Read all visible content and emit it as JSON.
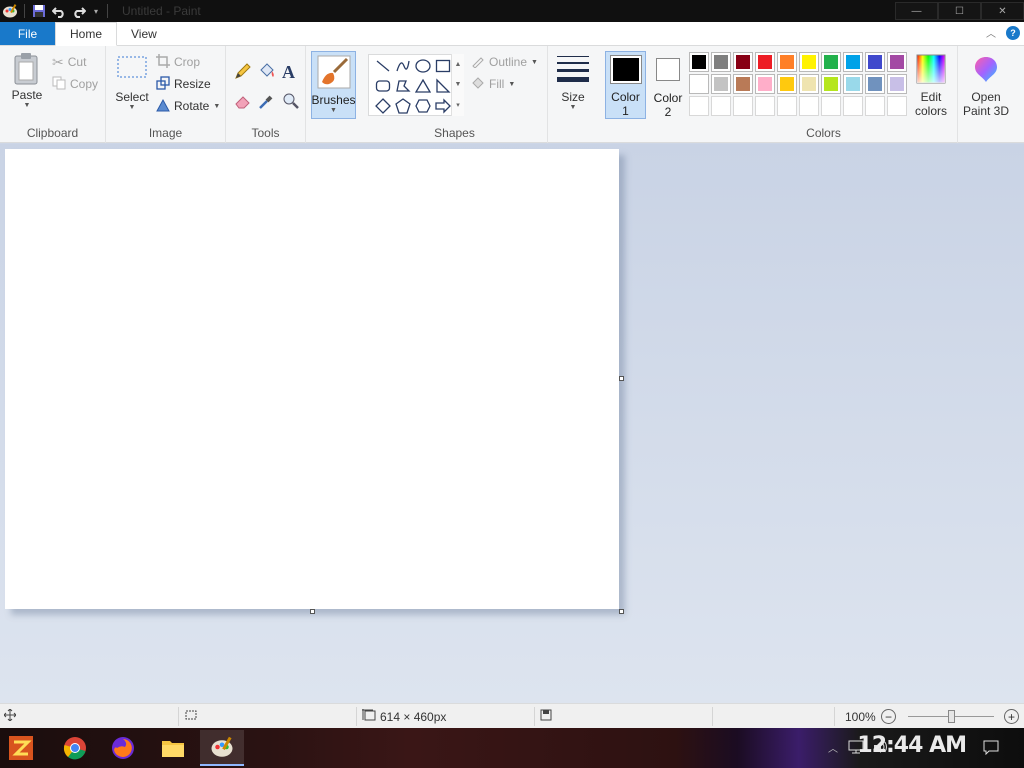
{
  "window": {
    "title": "Untitled - Paint"
  },
  "tabs": [
    {
      "label": "File"
    },
    {
      "label": "Home"
    },
    {
      "label": "View"
    }
  ],
  "ribbon": {
    "clipboard": {
      "label": "Clipboard",
      "paste": "Paste",
      "cut": "Cut",
      "copy": "Copy"
    },
    "image": {
      "label": "Image",
      "select": "Select",
      "crop": "Crop",
      "resize": "Resize",
      "rotate": "Rotate"
    },
    "tools": {
      "label": "Tools"
    },
    "brushes": {
      "label": "Brushes"
    },
    "shapes": {
      "label": "Shapes",
      "outline": "Outline",
      "fill": "Fill"
    },
    "size": {
      "label": "Size"
    },
    "color1": {
      "label_line1": "Color",
      "label_line2": "1",
      "value": "#000000"
    },
    "color2": {
      "label_line1": "Color",
      "label_line2": "2",
      "value": "#ffffff"
    },
    "colors": {
      "label": "Colors",
      "row1": [
        "#000000",
        "#7f7f7f",
        "#880015",
        "#ed1c24",
        "#ff7f27",
        "#fff200",
        "#22b14c",
        "#00a2e8",
        "#3f48cc",
        "#a349a4"
      ],
      "row2": [
        "#ffffff",
        "#c3c3c3",
        "#b97a57",
        "#ffaec9",
        "#ffc90e",
        "#efe4b0",
        "#b5e61d",
        "#99d9ea",
        "#7092be",
        "#c8bfe7"
      ],
      "row3": [
        "#ffffff",
        "#ffffff",
        "#ffffff",
        "#ffffff",
        "#ffffff",
        "#ffffff",
        "#ffffff",
        "#ffffff",
        "#ffffff",
        "#ffffff"
      ]
    },
    "edit_colors": {
      "line1": "Edit",
      "line2": "colors"
    },
    "paint3d": {
      "line1": "Open",
      "line2": "Paint 3D"
    }
  },
  "status": {
    "canvas_size": "614 × 460px",
    "zoom": "100%",
    "zoom_level": 100
  },
  "taskbar": {
    "time": "12:44 AM"
  }
}
